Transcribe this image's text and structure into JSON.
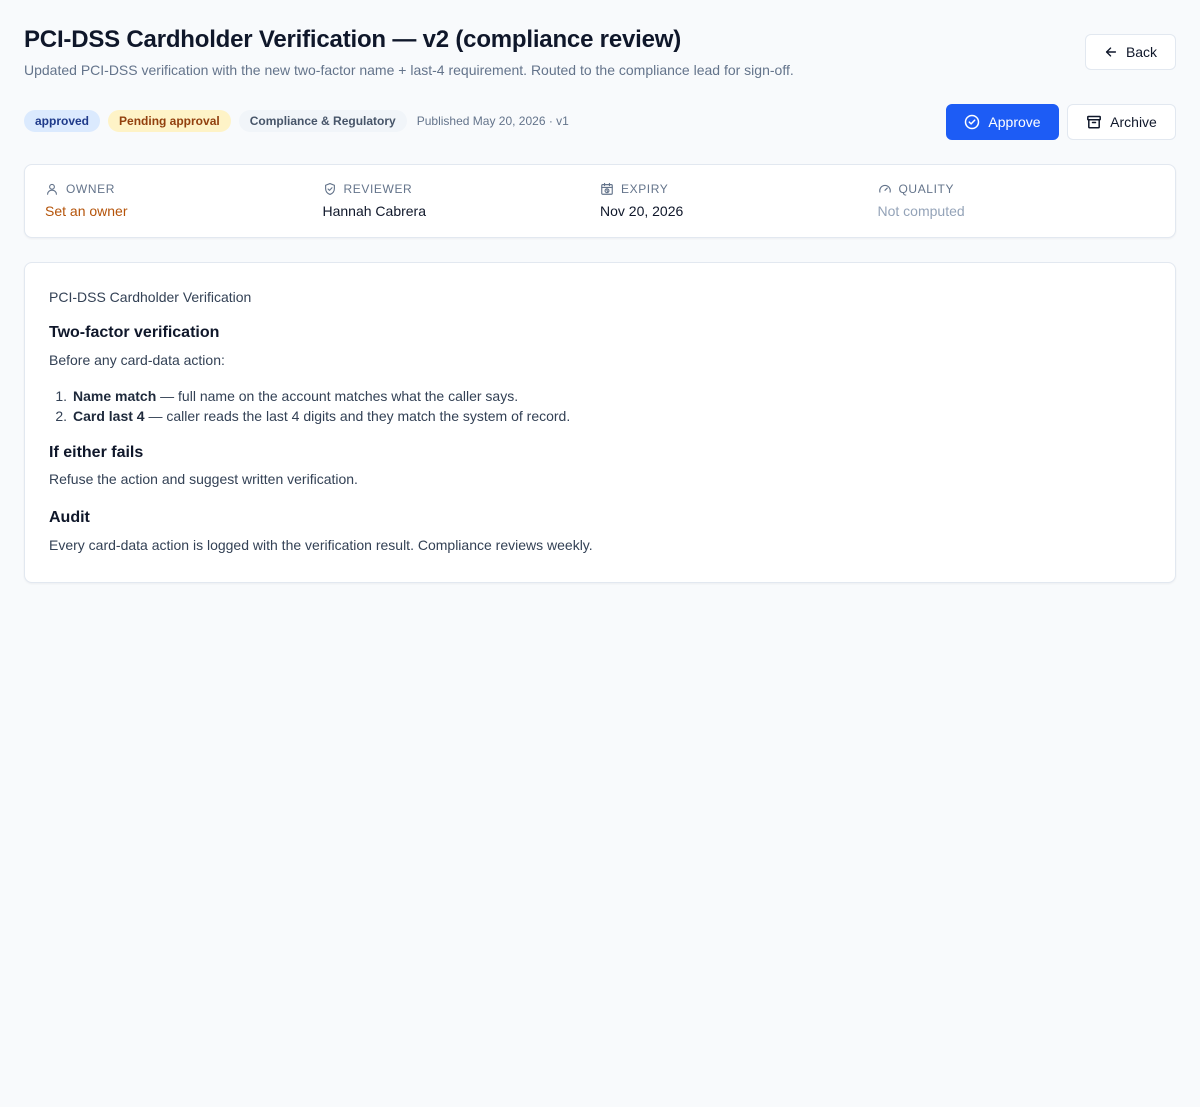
{
  "header": {
    "title": "PCI-DSS Cardholder Verification — v2 (compliance review)",
    "subtitle": "Updated PCI-DSS verification with the new two-factor name + last-4 requirement. Routed to the compliance lead for sign-off.",
    "back_label": "Back"
  },
  "meta": {
    "badges": {
      "status": "approved",
      "approval": "Pending approval",
      "category": "Compliance & Regulatory"
    },
    "published": "Published May 20, 2026 · v1"
  },
  "actions": {
    "approve_label": "Approve",
    "archive_label": "Archive"
  },
  "info": {
    "owner": {
      "label": "Owner",
      "value": "Set an owner"
    },
    "reviewer": {
      "label": "Reviewer",
      "value": "Hannah Cabrera"
    },
    "expiry": {
      "label": "Expiry",
      "value": "Nov 20, 2026"
    },
    "quality": {
      "label": "Quality",
      "value": "Not computed"
    }
  },
  "content": {
    "doc_title": "PCI-DSS Cardholder Verification",
    "sections": [
      {
        "heading": "Two-factor verification",
        "intro": "Before any card-data action:",
        "items": [
          {
            "num": "1.",
            "term": "Name match",
            "text": " — full name on the account matches what the caller says."
          },
          {
            "num": "2.",
            "term": "Card last 4",
            "text": " — caller reads the last 4 digits and they match the system of record."
          }
        ]
      },
      {
        "heading": "If either fails",
        "body": "Refuse the action and suggest written verification."
      },
      {
        "heading": "Audit",
        "body": "Every card-data action is logged with the verification result. Compliance reviews weekly."
      }
    ]
  },
  "colors": {
    "primary": "#1d5cf5",
    "owner_warning": "#b45309",
    "approved_badge_bg": "#dbeafe",
    "pending_badge_bg": "#fef3c7"
  }
}
